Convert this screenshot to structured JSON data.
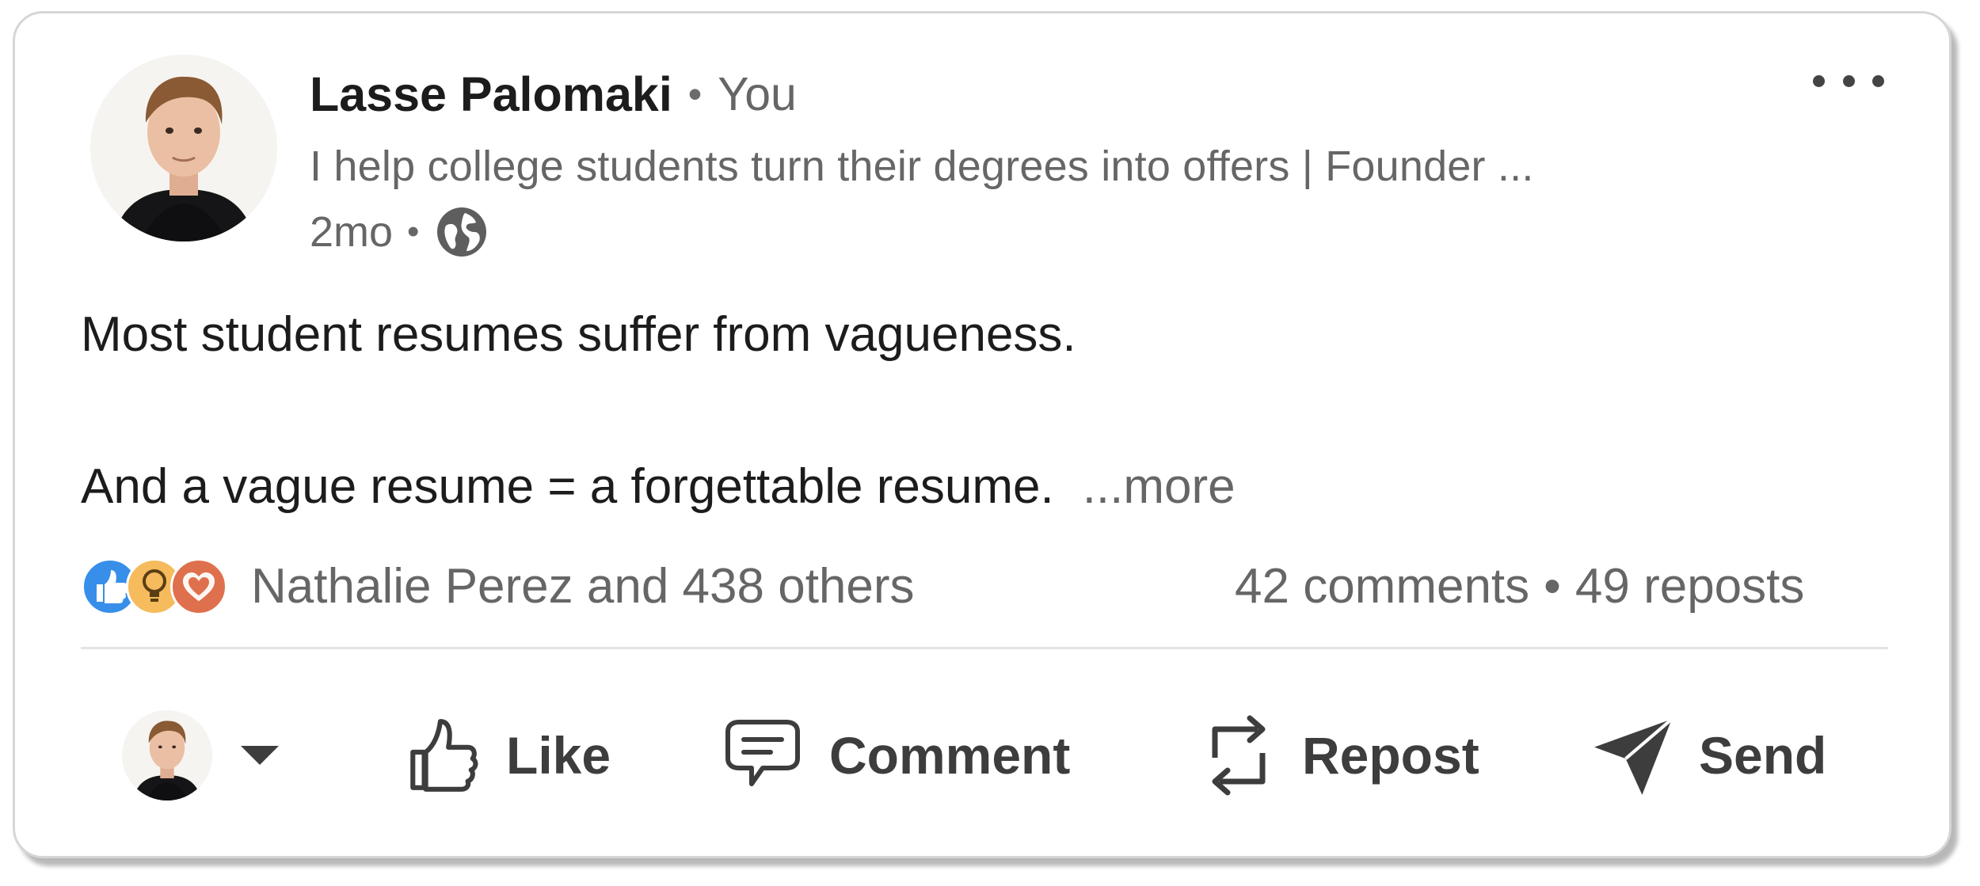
{
  "post": {
    "author": {
      "name": "Lasse Palomaki",
      "relation": "You",
      "headline": "I help college students turn their degrees into offers | Founder ...",
      "age": "2mo",
      "visibility_icon": "globe-icon"
    },
    "menu_icon": "more-horizontal-icon",
    "body": {
      "line1": "Most student resumes suffer from vagueness.",
      "line2": "And a vague resume = a forgettable resume.",
      "see_more": "...more"
    },
    "social": {
      "reaction_icons": [
        "like-reaction-icon",
        "insightful-reaction-icon",
        "love-reaction-icon"
      ],
      "likers": "Nathalie Perez and 438 others",
      "comments": "42 comments",
      "separator": "•",
      "reposts": "49 reposts"
    },
    "actions": {
      "actor_avatar": "avatar",
      "like": "Like",
      "comment": "Comment",
      "repost": "Repost",
      "send": "Send"
    }
  },
  "colors": {
    "text_primary": "#1c1c1c",
    "text_secondary": "#666666",
    "action_text": "#3d3d3d",
    "like_blue": "#378fe9",
    "insight_yellow": "#f5bb5c",
    "love_red": "#df704d"
  }
}
